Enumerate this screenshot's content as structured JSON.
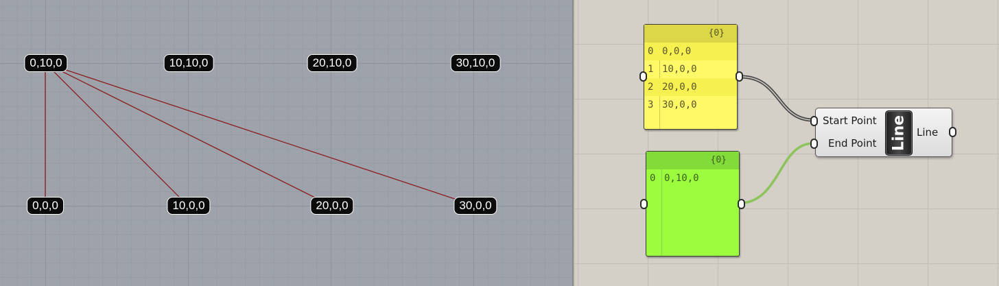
{
  "viewport": {
    "top_points": [
      "0,10,0",
      "10,10,0",
      "20,10,0",
      "30,10,0"
    ],
    "bottom_points": [
      "0,0,0",
      "10,0,0",
      "20,0,0",
      "30,0,0"
    ],
    "line_color": "#8b1b1b",
    "tag_color": "#0b0b0b"
  },
  "grasshopper": {
    "panel_start": {
      "path": "{0}",
      "rows": [
        {
          "index": "0",
          "value": "0,0,0"
        },
        {
          "index": "1",
          "value": "10,0,0"
        },
        {
          "index": "2",
          "value": "20,0,0"
        },
        {
          "index": "3",
          "value": "30,0,0"
        }
      ],
      "color": "#fff968"
    },
    "panel_end": {
      "path": "{0}",
      "rows": [
        {
          "index": "0",
          "value": "0,10,0"
        }
      ],
      "color": "#9bfd3e"
    },
    "line_component": {
      "nickname": "Line",
      "input_start": "Start Point",
      "input_end": "End Point",
      "output": "Line"
    },
    "wire_colors": {
      "start": "#4a4a4a",
      "end": "#8cc35a"
    }
  }
}
